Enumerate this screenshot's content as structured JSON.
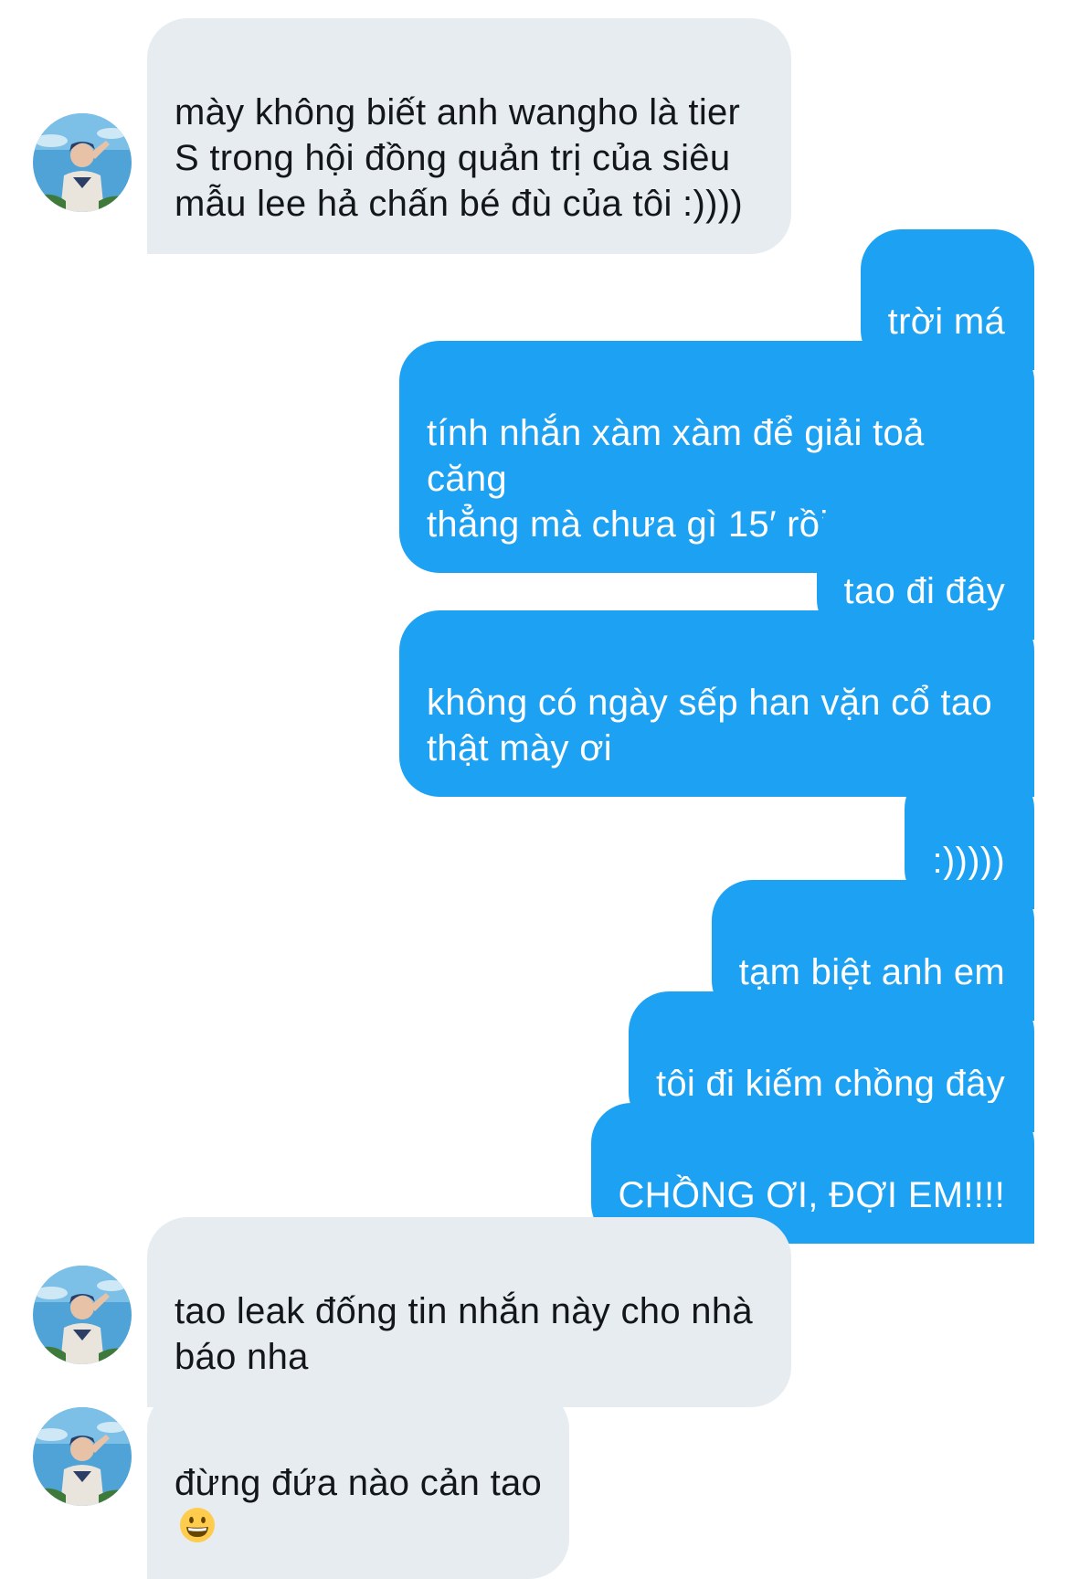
{
  "conversation": {
    "messages": [
      {
        "side": "in",
        "text": "mày không biết anh wangho là tier\nS trong hội đồng quản trị của siêu\nmẫu lee hả chấn bé đù của tôi :))))"
      },
      {
        "side": "out",
        "text": "trời má"
      },
      {
        "side": "out",
        "text": "tính nhắn xàm xàm để giải toả căng\nthẳng mà chưa gì 15′ rồi"
      },
      {
        "side": "out",
        "text": "tao đi đây"
      },
      {
        "side": "out",
        "text": "không có ngày sếp han vặn cổ tao\nthật mày ơi"
      },
      {
        "side": "out",
        "text": ":)))))"
      },
      {
        "side": "out",
        "text": "tạm biệt anh em"
      },
      {
        "side": "out",
        "text": "tôi đi kiếm chồng đây"
      },
      {
        "side": "out",
        "text": "CHỒNG ƠI, ĐỢI EM!!!!"
      },
      {
        "side": "in",
        "text": "tao leak đống tin nhắn này cho nhà\nbáo nha"
      },
      {
        "side": "in",
        "text": "đừng đứa nào cản tao",
        "emoji": "grinning-face-emoji"
      }
    ]
  },
  "colors": {
    "outgoing_bubble": "#1da1f2",
    "incoming_bubble": "#e6ecf0",
    "incoming_text": "#14171a",
    "outgoing_text": "#ffffff"
  }
}
